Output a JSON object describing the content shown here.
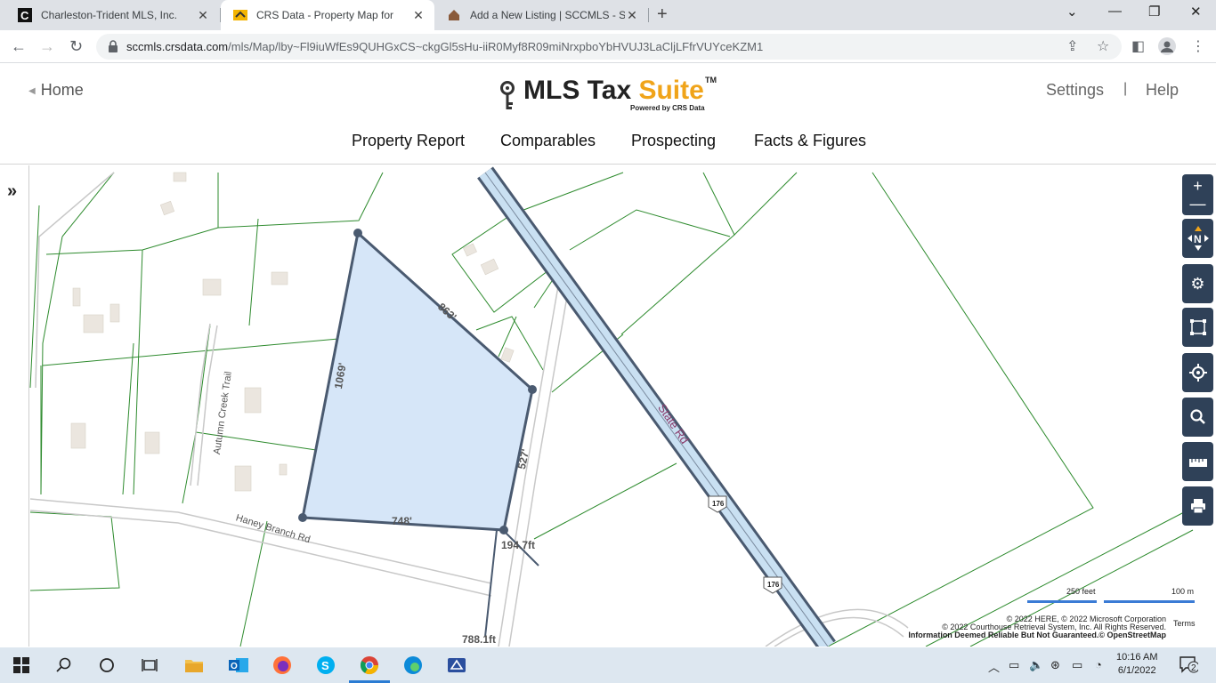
{
  "browser": {
    "tabs": [
      {
        "title": "Charleston-Trident MLS, Inc.",
        "favicon": "letter-c-icon",
        "active": false
      },
      {
        "title": "CRS Data - Property Map for",
        "favicon": "crs-data-icon",
        "active": true
      },
      {
        "title": "Add a New Listing | SCCMLS - Sc",
        "favicon": "house-icon",
        "active": false
      }
    ],
    "url_host": "sccmls.crsdata.com",
    "url_path": "/mls/Map/lby~Fl9iuWfEs9QUHGxCS~ckgGl5sHu-iiR0Myf8R09miNrxpboYbHVUJ3LaCljLFfrVUYceKZM1"
  },
  "header": {
    "home_label": "Home",
    "logo_main": "MLS Tax ",
    "logo_accent": "Suite",
    "logo_tm": "TM",
    "logo_powered": "Powered by CRS Data",
    "settings_label": "Settings",
    "divider": "|",
    "help_label": "Help",
    "accent_color": "#f0a41a"
  },
  "nav": {
    "items": [
      "Property Report",
      "Comparables",
      "Prospecting",
      "Facts & Figures"
    ]
  },
  "map": {
    "parcel_dimensions": [
      "863'",
      "1069'",
      "527'",
      "748'"
    ],
    "measure_labels": [
      "194.7ft",
      "788.1ft"
    ],
    "road_labels": [
      "State Rd",
      "Autumn Creek Trail",
      "Haney Branch Rd"
    ],
    "route_shield": "176",
    "parcel_fill": "#d6e6f8",
    "parcel_stroke": "#4a5a70",
    "lot_line_color": "#2e8b2e",
    "scale_feet": "250 feet",
    "scale_meters": "100 m",
    "attribution_1": "© 2022 HERE, © 2022 Microsoft Corporation",
    "attribution_2": "© 2022 Courthouse Retrieval System, Inc. All Rights Reserved.",
    "attribution_3": "Information Deemed Reliable But Not Guaranteed.© OpenStreetMap",
    "terms_label": "Terms",
    "controls": [
      "zoom-in",
      "zoom-out",
      "compass-north",
      "settings",
      "select-area",
      "locate",
      "search",
      "measure",
      "print"
    ],
    "compass_letter": "N"
  },
  "taskbar": {
    "time": "10:16 AM",
    "date": "6/1/2022",
    "notification_count": "2"
  }
}
